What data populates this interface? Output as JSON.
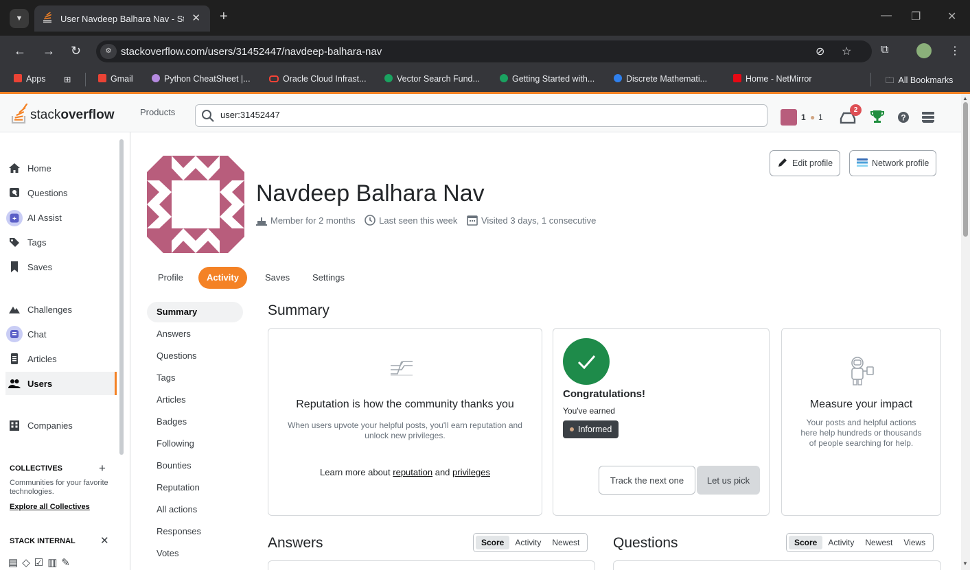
{
  "browser": {
    "tab_title": "User Navdeep Balhara Nav - Stack Overflow",
    "url": "stackoverflow.com/users/31452447/navdeep-balhara-nav",
    "new_tab": "+",
    "bookmarks": [
      {
        "label": "Apps"
      },
      {
        "label": "Gmail"
      },
      {
        "label": "Python CheatSheet |..."
      },
      {
        "label": "Oracle Cloud Infrast..."
      },
      {
        "label": "Vector Search Fund..."
      },
      {
        "label": "Getting Started with..."
      },
      {
        "label": "Discrete Mathemati..."
      },
      {
        "label": "Home - NetMirror"
      }
    ],
    "all_bookmarks": "All Bookmarks"
  },
  "topbar": {
    "logo_light": "stack",
    "logo_bold": "overflow",
    "products": "Products",
    "search_value": "user:31452447",
    "reputation": "1",
    "bronze_count": "1",
    "inbox_count": "2"
  },
  "sidebar": {
    "items": [
      {
        "label": "Home"
      },
      {
        "label": "Questions"
      },
      {
        "label": "AI Assist"
      },
      {
        "label": "Tags"
      },
      {
        "label": "Saves"
      },
      {
        "label": "Challenges"
      },
      {
        "label": "Chat"
      },
      {
        "label": "Articles"
      },
      {
        "label": "Users"
      },
      {
        "label": "Companies"
      }
    ],
    "collectives_heading": "COLLECTIVES",
    "collectives_text": "Communities for your favorite technologies.",
    "collectives_link": "Explore all Collectives",
    "internal_heading": "STACK INTERNAL"
  },
  "profile": {
    "name": "Navdeep Balhara Nav",
    "member_for": "Member for 2 months",
    "last_seen": "Last seen this week",
    "visited": "Visited 3 days, 1 consecutive",
    "edit_profile": "Edit profile",
    "network_profile": "Network profile",
    "tabs": [
      "Profile",
      "Activity",
      "Saves",
      "Settings"
    ]
  },
  "subnav": [
    "Summary",
    "Answers",
    "Questions",
    "Tags",
    "Articles",
    "Badges",
    "Following",
    "Bounties",
    "Reputation",
    "All actions",
    "Responses",
    "Votes"
  ],
  "summary": {
    "heading": "Summary",
    "rep_card": {
      "title": "Reputation is how the community thanks you",
      "text": "When users upvote your helpful posts, you'll earn reputation and unlock new privileges.",
      "learn_prefix": "Learn more about",
      "link_reputation": "reputation",
      "learn_and": "and",
      "link_privileges": "privileges"
    },
    "badge_card": {
      "title": "Congratulations!",
      "subtitle": "You've earned",
      "badge": "Informed",
      "track_button": "Track the next one",
      "pick_button": "Let us pick"
    },
    "impact_card": {
      "title": "Measure your impact",
      "text": "Your posts and helpful actions here help hundreds or thousands of people searching for help."
    }
  },
  "answers": {
    "heading": "Answers",
    "filters": [
      "Score",
      "Activity",
      "Newest"
    ]
  },
  "questions": {
    "heading": "Questions",
    "filters": [
      "Score",
      "Activity",
      "Newest",
      "Views"
    ]
  },
  "colors": {
    "accent": "#f48225",
    "avatar": "#b85d7c",
    "success": "#1e8b4a"
  }
}
